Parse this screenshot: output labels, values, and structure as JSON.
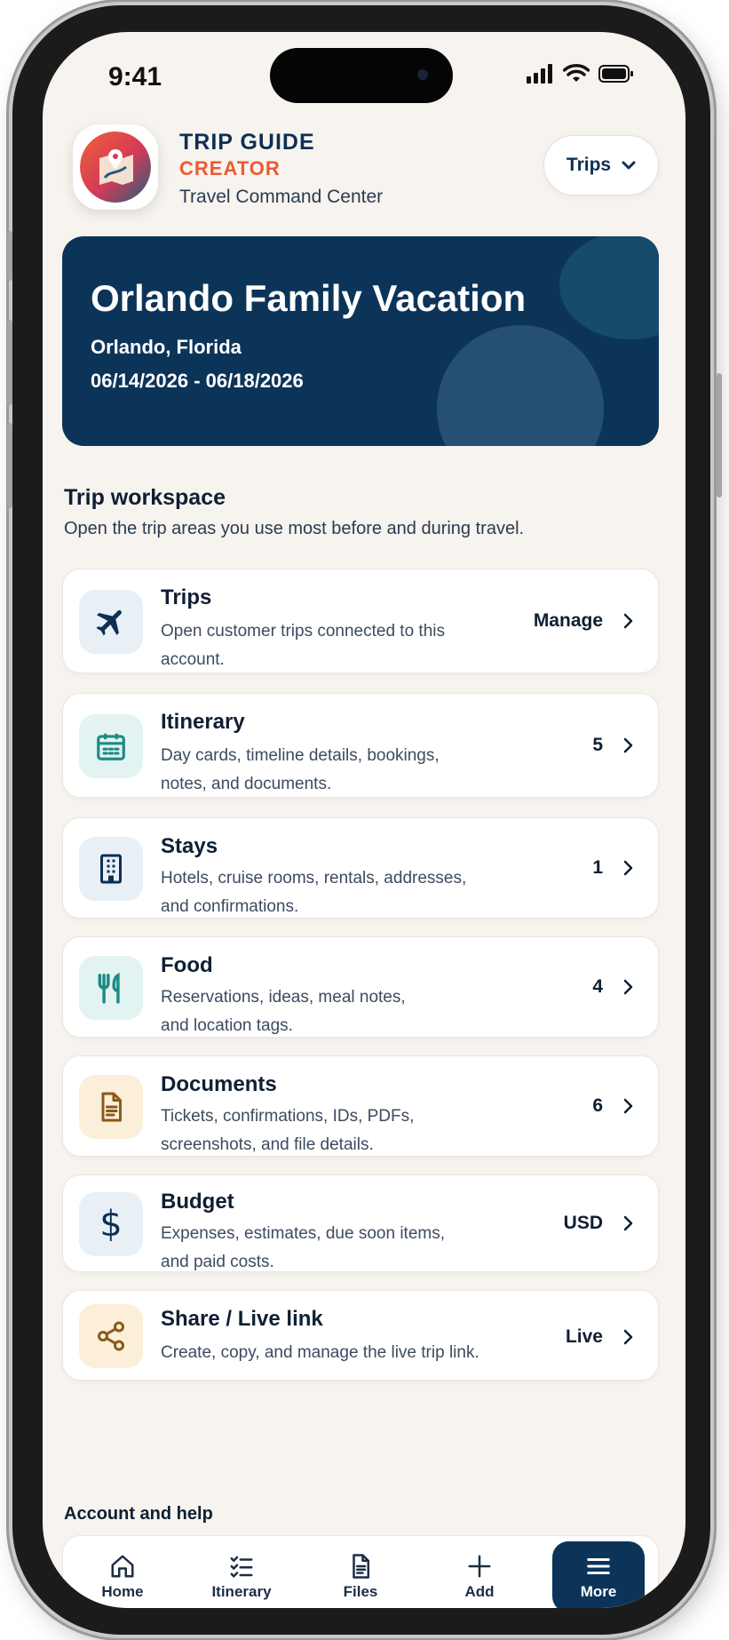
{
  "status": {
    "time": "9:41"
  },
  "header": {
    "brand_title": "TRIP GUIDE",
    "brand_subtitle": "CREATOR",
    "tagline": "Travel Command Center",
    "trips_button": "Trips"
  },
  "hero": {
    "title": "Orlando Family Vacation",
    "location": "Orlando, Florida",
    "dates": "06/14/2026 - 06/18/2026"
  },
  "workspace": {
    "title": "Trip workspace",
    "description": "Open the trip areas you use most before and during travel.",
    "items": [
      {
        "title": "Trips",
        "desc1": "Open customer trips connected to this",
        "desc2": "account.",
        "meta": "Manage",
        "icon": "airplane-icon",
        "icon_bg": "#e8f0f6",
        "icon_color": "#0e2f55"
      },
      {
        "title": "Itinerary",
        "desc1": "Day cards, timeline details, bookings,",
        "desc2": "notes, and documents.",
        "meta": "5",
        "icon": "calendar-icon",
        "icon_bg": "#e3f3f1",
        "icon_color": "#1f8b85"
      },
      {
        "title": "Stays",
        "desc1": "Hotels, cruise rooms, rentals, addresses,",
        "desc2": "and confirmations.",
        "meta": "1",
        "icon": "building-icon",
        "icon_bg": "#e8f0f6",
        "icon_color": "#0e2f55"
      },
      {
        "title": "Food",
        "desc1": "Reservations, ideas, meal notes,",
        "desc2": "and location tags.",
        "meta": "4",
        "icon": "utensils-icon",
        "icon_bg": "#e3f3f1",
        "icon_color": "#1f8b85"
      },
      {
        "title": "Documents",
        "desc1": "Tickets, confirmations, IDs, PDFs,",
        "desc2": "screenshots, and file details.",
        "meta": "6",
        "icon": "document-icon",
        "icon_bg": "#fbefd9",
        "icon_color": "#8a5a1a"
      },
      {
        "title": "Budget",
        "desc1": "Expenses, estimates, due soon items,",
        "desc2": "and paid costs.",
        "meta": "USD",
        "icon": "dollar-icon",
        "icon_bg": "#e8f0f6",
        "icon_color": "#0e2f55"
      },
      {
        "title": "Share / Live link",
        "desc1": "Create, copy, and manage the live trip link.",
        "desc2": "",
        "meta": "Live",
        "icon": "share-icon",
        "icon_bg": "#fbefd9",
        "icon_color": "#8a5a1a"
      }
    ]
  },
  "account": {
    "title": "Account and help"
  },
  "tabbar": {
    "tabs": [
      {
        "label": "Home",
        "icon": "home-icon"
      },
      {
        "label": "Itinerary",
        "icon": "checklist-icon"
      },
      {
        "label": "Files",
        "icon": "file-icon"
      },
      {
        "label": "Add",
        "icon": "plus-icon"
      },
      {
        "label": "More",
        "icon": "menu-icon",
        "active": true
      }
    ]
  },
  "colors": {
    "navy": "#0c3459",
    "accent_orange": "#ec5a33",
    "background": "#f7f3ee"
  }
}
